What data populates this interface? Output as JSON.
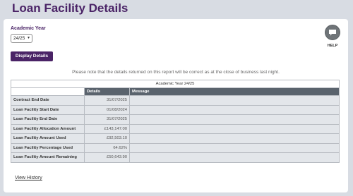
{
  "page": {
    "title": "Loan Facility Details"
  },
  "filters": {
    "academic_year_label": "Academic Year",
    "academic_year_value": "24/25"
  },
  "help": {
    "label": "HELP"
  },
  "actions": {
    "display_details": "Display Details",
    "view_history": "View History"
  },
  "note": "Please note that the details returned on this report will be correct as at the close of business last night.",
  "table": {
    "caption": "Academic Year 24/25",
    "headers": {
      "details": "Details",
      "message": "Message"
    },
    "rows": [
      {
        "label": "Contract End Date",
        "value": "31/07/2025",
        "message": ""
      },
      {
        "label": "Loan Facility Start Date",
        "value": "01/08/2024",
        "message": ""
      },
      {
        "label": "Loan Facility End Date",
        "value": "31/07/2025",
        "message": ""
      },
      {
        "label": "Loan Facility Allocation Amount",
        "value": "£143,147.00",
        "message": ""
      },
      {
        "label": "Loan Facility Amount Used",
        "value": "£92,503.10",
        "message": ""
      },
      {
        "label": "Loan Facility Percentage Used",
        "value": "64.62%",
        "message": ""
      },
      {
        "label": "Loan Facility Amount Remaining",
        "value": "£50,643.90",
        "message": ""
      }
    ]
  },
  "colors": {
    "brand": "#4a2366",
    "table_header": "#5a636d",
    "row_bg": "#e3e6ea"
  },
  "icons": {
    "help": "chat-bubble-icon",
    "select_caret": "chevron-down-icon"
  }
}
